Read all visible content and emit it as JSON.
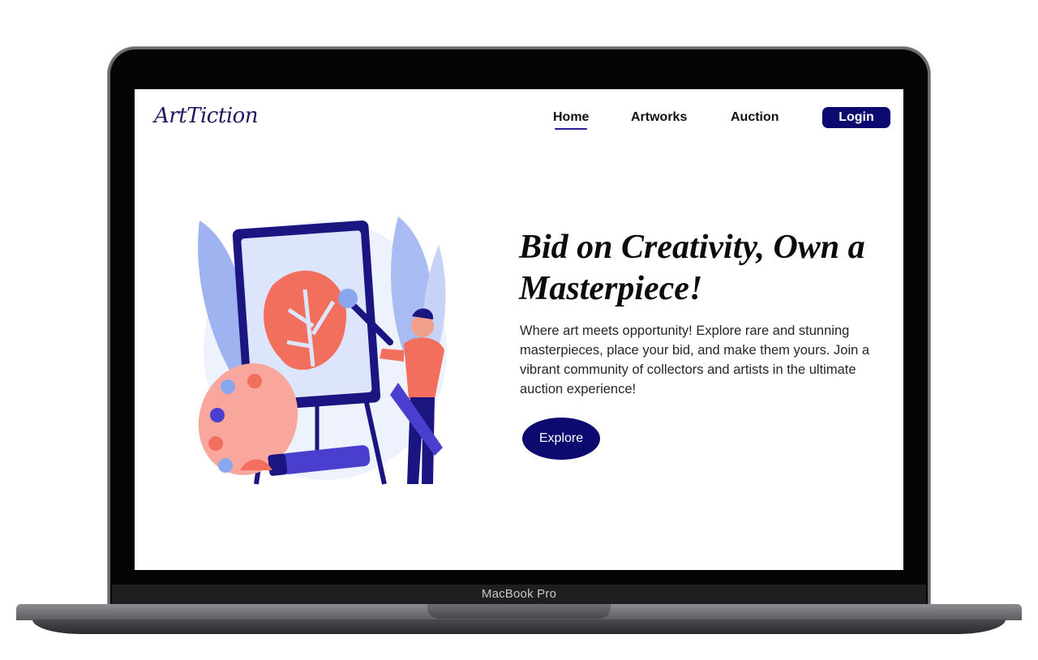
{
  "device": {
    "label": "MacBook Pro"
  },
  "site": {
    "logo": "ArtTiction",
    "nav": {
      "home": "Home",
      "artworks": "Artworks",
      "auction": "Auction",
      "login": "Login"
    },
    "hero": {
      "title": "Bid on Creativity, Own a Masterpiece!",
      "description": "Where art meets opportunity! Explore rare and stunning masterpieces, place your bid, and make them yours. Join a vibrant community of collectors and artists in the ultimate auction experience!",
      "cta": "Explore",
      "illustration": "artist-painting-illustration"
    }
  },
  "colors": {
    "brand_navy": "#0c0a6e",
    "accent_coral": "#f26f5e",
    "accent_blue": "#8aa6ee"
  }
}
